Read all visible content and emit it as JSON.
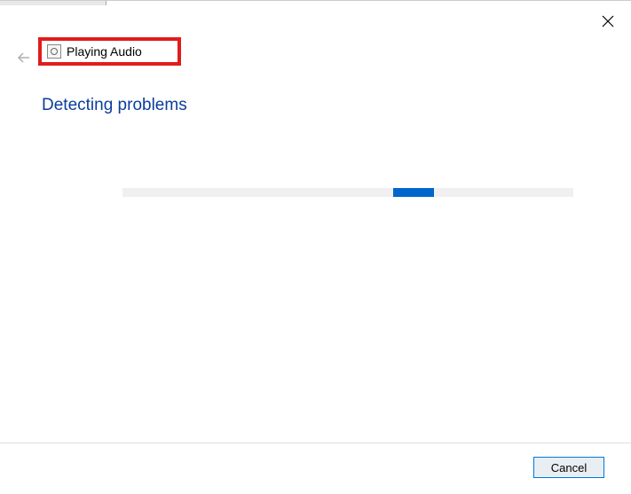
{
  "window": {
    "title": "Playing Audio",
    "close_label": "Close"
  },
  "heading": "Detecting problems",
  "progress": {
    "indeterminate": true
  },
  "buttons": {
    "cancel": "Cancel",
    "back": "Back"
  },
  "highlight": {
    "color": "#e11c1c"
  }
}
